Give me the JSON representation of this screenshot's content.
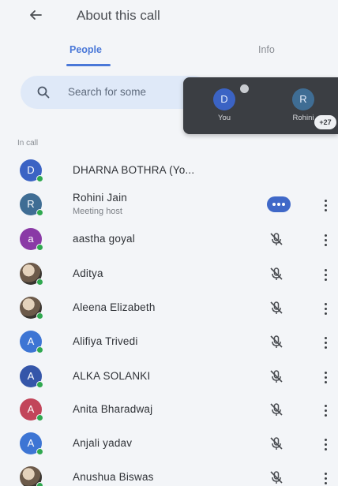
{
  "header": {
    "back_icon": "arrow-left-icon",
    "title": "About this call"
  },
  "tabs": [
    {
      "label": "People",
      "active": true
    },
    {
      "label": "Info",
      "active": false
    }
  ],
  "search": {
    "icon": "search-icon",
    "placeholder": "Search for some"
  },
  "pip": {
    "tiles": [
      {
        "initial": "D",
        "name": "You",
        "color": "#3b63c4"
      },
      {
        "initial": "R",
        "name": "Rohini",
        "color": "#3f6d94"
      }
    ],
    "overflow_count": "+27"
  },
  "section_label": "In call",
  "colors": {
    "accent": "#4a78d8",
    "online": "#2fa84f",
    "speaking": "#3f68c8"
  },
  "participants": [
    {
      "initial": "D",
      "name": "DHARNA BOTHRA (Yo...",
      "avatar_color": "#3b63c4",
      "status": "none"
    },
    {
      "initial": "R",
      "name": "Rohini Jain",
      "subtitle": "Meeting host",
      "avatar_color": "#3f6d94",
      "status": "speaking"
    },
    {
      "initial": "a",
      "name": "aastha goyal",
      "avatar_color": "#8a3aa6",
      "status": "muted"
    },
    {
      "initial": "",
      "name": "Aditya",
      "avatar_color": "photo",
      "status": "muted"
    },
    {
      "initial": "",
      "name": "Aleena Elizabeth",
      "avatar_color": "photo",
      "status": "muted"
    },
    {
      "initial": "A",
      "name": "Alifiya Trivedi",
      "avatar_color": "#3d75d4",
      "status": "muted"
    },
    {
      "initial": "A",
      "name": "ALKA SOLANKI",
      "avatar_color": "#3556a9",
      "status": "muted"
    },
    {
      "initial": "A",
      "name": "Anita Bharadwaj",
      "avatar_color": "#c2455a",
      "status": "muted"
    },
    {
      "initial": "A",
      "name": "Anjali yadav",
      "avatar_color": "#3d75d4",
      "status": "muted"
    },
    {
      "initial": "",
      "name": "Anushua Biswas",
      "avatar_color": "photo",
      "status": "muted"
    }
  ]
}
